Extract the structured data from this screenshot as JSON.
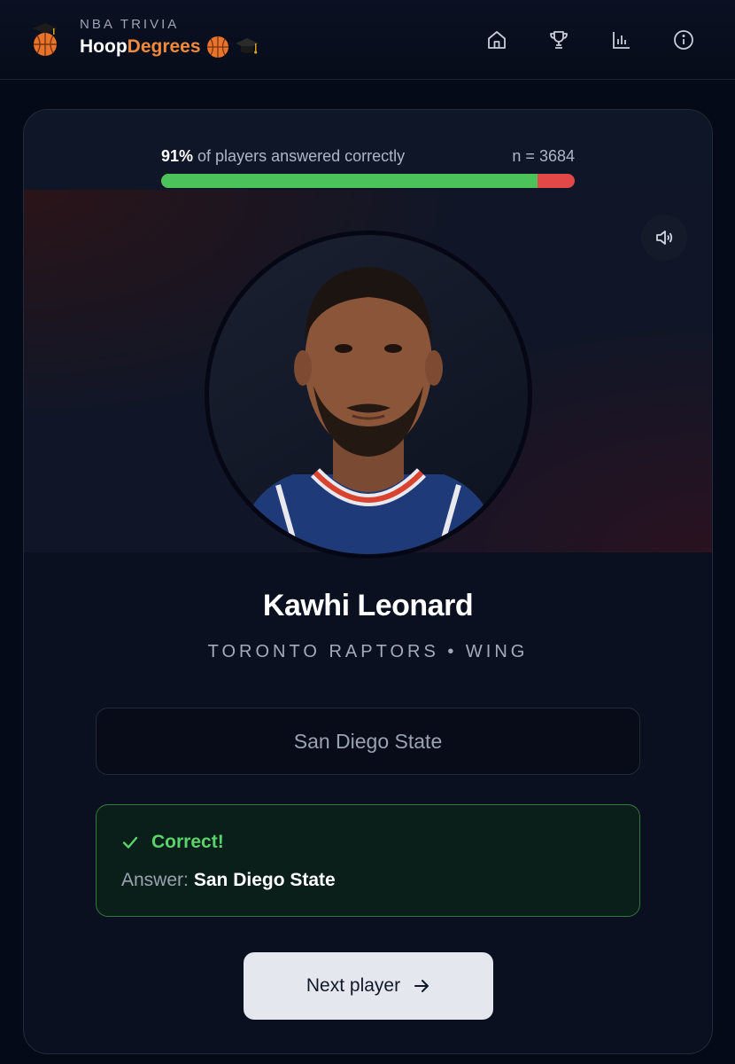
{
  "header": {
    "kicker": "NBA TRIVIA",
    "title_part1": "Hoop",
    "title_part2": "Degrees",
    "nav": [
      {
        "icon": "home-icon"
      },
      {
        "icon": "trophy-icon"
      },
      {
        "icon": "bar-chart-icon"
      },
      {
        "icon": "info-icon"
      }
    ]
  },
  "stats": {
    "percent_label": "91%",
    "percent_suffix": " of players answered correctly",
    "sample_label": "n = 3684",
    "correct_fraction": 0.91
  },
  "player": {
    "name": "Kawhi Leonard",
    "meta": "TORONTO RAPTORS • WING"
  },
  "answer_input": {
    "value": "San Diego State"
  },
  "result": {
    "status": "Correct!",
    "answer_label": "Answer:",
    "answer_value": "San Diego State"
  },
  "next_button": {
    "label": "Next player"
  },
  "colors": {
    "accent": "#f08a3c",
    "correct": "#4cc35a",
    "incorrect": "#e24848"
  }
}
